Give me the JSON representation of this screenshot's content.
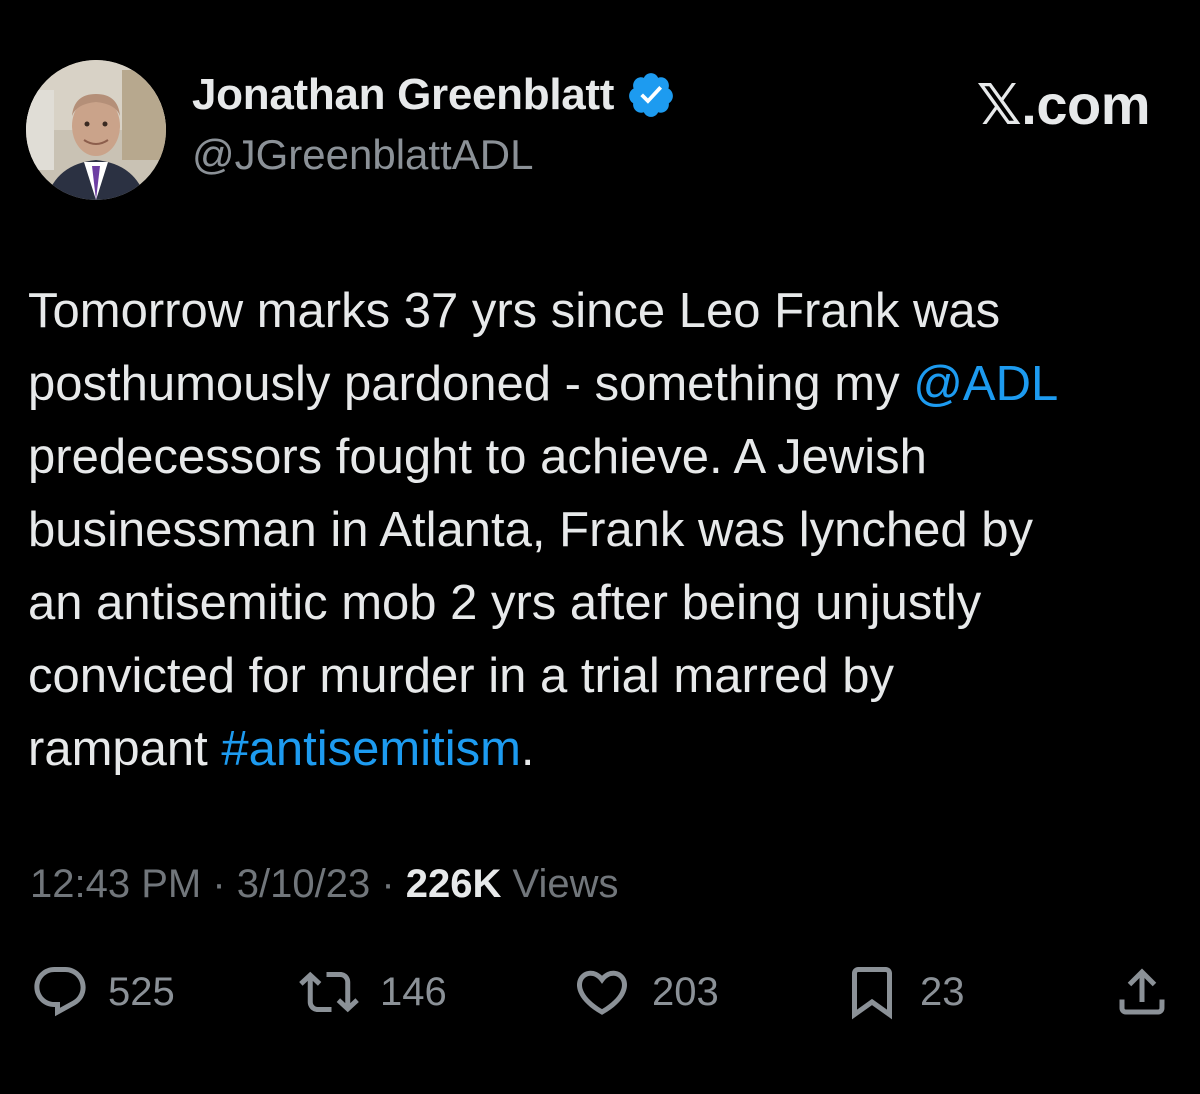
{
  "author": {
    "display_name": "Jonathan Greenblatt",
    "handle": "@JGreenblattADL",
    "verified_icon": "verified-badge-icon",
    "avatar": "profile-photo"
  },
  "brand": {
    "label": "𝕏.com"
  },
  "tweet": {
    "lines": [
      {
        "segments": [
          {
            "text": "Tomorrow marks 37 yrs since Leo Frank was",
            "link": false
          }
        ]
      },
      {
        "segments": [
          {
            "text": "posthumously pardoned - something my ",
            "link": false
          },
          {
            "text": "@ADL",
            "link": true
          }
        ]
      },
      {
        "segments": [
          {
            "text": "predecessors fought to achieve. A Jewish",
            "link": false
          }
        ]
      },
      {
        "segments": [
          {
            "text": "businessman in Atlanta, Frank was lynched by",
            "link": false
          }
        ]
      },
      {
        "segments": [
          {
            "text": "an antisemitic mob 2 yrs after being unjustly",
            "link": false
          }
        ]
      },
      {
        "segments": [
          {
            "text": "convicted for murder in a trial marred by",
            "link": false
          }
        ]
      },
      {
        "segments": [
          {
            "text": "rampant ",
            "link": false
          },
          {
            "text": "#antisemitism",
            "link": true
          },
          {
            "text": ".",
            "link": false
          }
        ]
      }
    ]
  },
  "meta": {
    "time": "12:43 PM",
    "sep1": " · ",
    "date": "3/10/23",
    "sep2": " · ",
    "views_count": "226K",
    "views_label": " Views"
  },
  "actions": {
    "replies": {
      "icon": "reply-icon",
      "count": "525"
    },
    "reposts": {
      "icon": "repost-icon",
      "count": "146"
    },
    "likes": {
      "icon": "heart-icon",
      "count": "203"
    },
    "bookmarks": {
      "icon": "bookmark-icon",
      "count": "23"
    },
    "share": {
      "icon": "share-icon"
    }
  },
  "colors": {
    "background": "#000000",
    "text": "#e7e9ea",
    "secondary": "#71767b",
    "link": "#1d9bf0",
    "verified": "#1d9bf0"
  }
}
